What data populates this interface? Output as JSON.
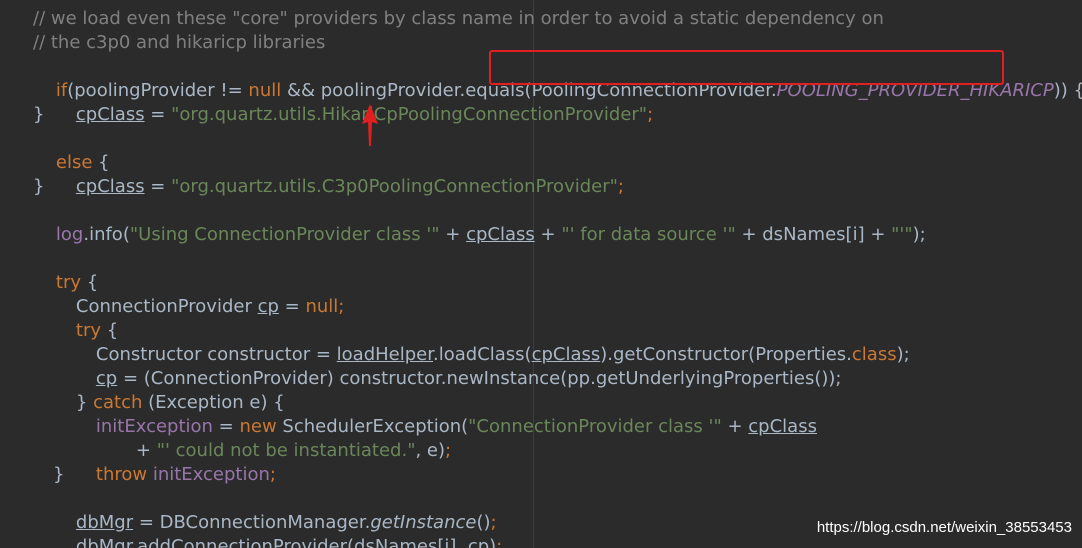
{
  "code": {
    "l1": "// we load even these \"core\" providers by class name in order to avoid a static dependency on",
    "l2": "// the c3p0 and hikaricp libraries",
    "l3": {
      "kw_if": "if",
      "a": "(poolingProvider != ",
      "kw_null": "null",
      "b": " && poolingProvider.equals(",
      "cls": "PoolingConnectionProvider.",
      "const": "POOLING_PROVIDER_HIKARICP",
      "c": ")) {"
    },
    "l4": {
      "var": "cpClass",
      "eq": " = ",
      "str": "\"org.quartz.utils.HikariCpPoolingConnectionProvider\"",
      "semi": ";"
    },
    "l5": "}",
    "l6": {
      "kw": "else",
      "rest": " {"
    },
    "l7": {
      "var": "cpClass",
      "eq": " = ",
      "str": "\"org.quartz.utils.C3p0PoolingConnectionProvider\"",
      "semi": ";"
    },
    "l8": "}",
    "l9": {
      "log": "log",
      "a": ".info(",
      "s1": "\"Using ConnectionProvider class '\"",
      "b": " + ",
      "var": "cpClass",
      "c": " + ",
      "s2": "\"' for data source '\"",
      "d": " + dsNames[i] + ",
      "s3": "\"'\"",
      "e": ");"
    },
    "l11": {
      "kw": "try",
      "rest": " {"
    },
    "l12": {
      "a": "ConnectionProvider ",
      "var": "cp",
      "b": " = ",
      "kw_null": "null",
      "semi": ";"
    },
    "l13": {
      "kw": "try",
      "rest": " {"
    },
    "l14": {
      "a": "Constructor constructor = ",
      "lh": "loadHelper",
      "b": ".loadClass(",
      "var": "cpClass",
      "c": ").getConstructor(Properties.",
      "kw": "class",
      "d": ");"
    },
    "l15": {
      "var": "cp",
      "rest": " = (ConnectionProvider) constructor.newInstance(pp.getUnderlyingProperties());"
    },
    "l16": {
      "a": "} ",
      "kw": "catch",
      "b": " (Exception e) {"
    },
    "l17": {
      "fld": "initException",
      "a": " = ",
      "kw": "new",
      "b": " SchedulerException(",
      "s": "\"ConnectionProvider class '\"",
      "c": " + ",
      "var": "cpClass"
    },
    "l18": {
      "a": "+ ",
      "s": "\"' could not be instantiated.\"",
      "b": ", e)",
      "semi": ";"
    },
    "l19": {
      "kw": "throw",
      "a": " ",
      "fld": "initException",
      "semi": ";"
    },
    "l20": "}",
    "l21": {
      "var": "dbMgr",
      "a": " = DBConnectionManager.",
      "m": "getInstance",
      "b": "()",
      "semi": ";"
    },
    "l22": {
      "var": "dbMgr",
      "a": ".addConnectionProvider(dsNames[i], ",
      "v2": "cp",
      "b": ")",
      "semi": ";"
    }
  },
  "colors": {
    "background": "#2b2b2b",
    "text": "#a9b7c6",
    "keyword": "#cc7832",
    "string": "#6a8759",
    "comment": "#808080",
    "field": "#9876aa",
    "annotation_red": "#e02020"
  },
  "watermark": "https://blog.csdn.net/weixin_38553453"
}
